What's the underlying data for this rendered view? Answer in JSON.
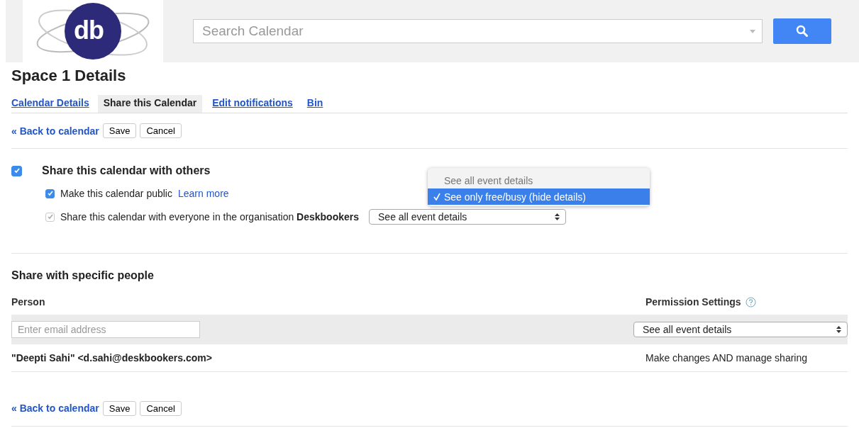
{
  "header": {
    "logo_text": "db",
    "search": {
      "placeholder": "Search Calendar"
    }
  },
  "title": "Space 1 Details",
  "tabs": [
    {
      "label": "Calendar Details",
      "selected": false
    },
    {
      "label": "Share this Calendar",
      "selected": true
    },
    {
      "label": "Edit notifications",
      "selected": false
    },
    {
      "label": "Bin",
      "selected": false
    }
  ],
  "top_actions": {
    "back_link": "« Back to calendar",
    "buttons": [
      "Save",
      "Cancel"
    ]
  },
  "share": {
    "checked": true,
    "label": "Share this calendar with others",
    "options": [
      {
        "label": "Make this calendar public",
        "link": "Learn more",
        "checked": true,
        "disabled": false
      },
      {
        "label": "Share this calendar with everyone in the organisation **Deskbookers**",
        "checked": true,
        "disabled": true,
        "select": "See all event details"
      }
    ],
    "menu": [
      {
        "label": "See all event details",
        "selected": false
      },
      {
        "label": "See only free/busy (hide details)",
        "selected": true
      }
    ]
  },
  "people": {
    "heading": "Share with specific people",
    "columns": [
      "Person",
      "Permission Settings"
    ],
    "input": {
      "placeholder": "Enter email address"
    },
    "permission_select": "See all event details",
    "rows": [
      {
        "person": "\"Deepti Sahi\" <d.sahi@deskbookers.com>",
        "permission": "Make changes AND manage sharing"
      }
    ]
  },
  "bottom_actions": {
    "back_link": "« Back to calendar",
    "buttons": [
      "Save",
      "Cancel"
    ]
  }
}
